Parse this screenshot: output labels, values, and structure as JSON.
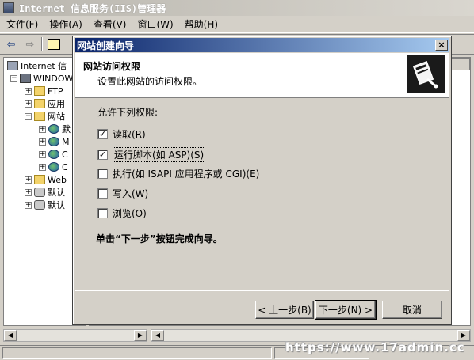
{
  "window": {
    "title": "Internet 信息服务(IIS)管理器"
  },
  "menubar": {
    "items": [
      "文件(F)",
      "操作(A)",
      "查看(V)",
      "窗口(W)",
      "帮助(H)"
    ]
  },
  "tree": {
    "root": "Internet 信",
    "server": "WINDOWS",
    "ftp": "FTP",
    "app": "应用",
    "web": "网站",
    "web_children": [
      "默",
      "M",
      "C",
      "C"
    ],
    "webext": "Web",
    "default1": "默认",
    "default2": "默认"
  },
  "dialog": {
    "title": "网站创建向导",
    "close_label": "×",
    "heading": "网站访问权限",
    "subheading": "设置此网站的访问权限。",
    "allow_label": "允许下列权限:",
    "permissions": [
      {
        "label": "读取(R)",
        "checked": true
      },
      {
        "label": "运行脚本(如 ASP)(S)",
        "checked": true
      },
      {
        "label": "执行(如 ISAPI 应用程序或 CGI)(E)",
        "checked": false
      },
      {
        "label": "写入(W)",
        "checked": false
      },
      {
        "label": "浏览(O)",
        "checked": false
      }
    ],
    "finish_text": "单击“下一步”按钮完成向导。",
    "buttons": {
      "back": "< 上一步(B)",
      "next": "下一步(N) >",
      "cancel": "取消"
    }
  },
  "watermark": "https://www.17admin.cc"
}
